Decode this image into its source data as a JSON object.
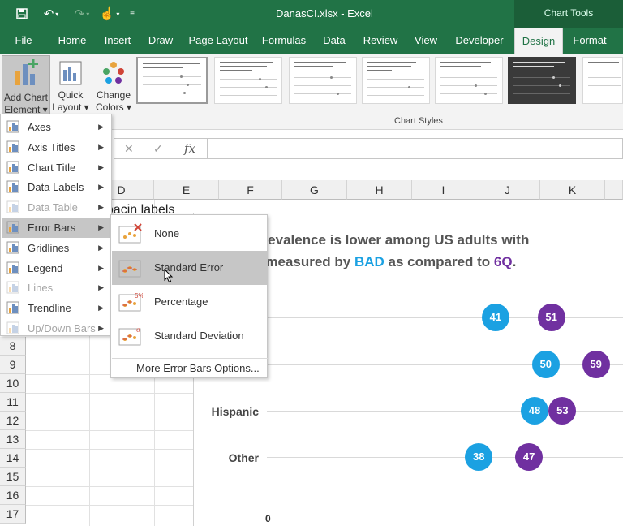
{
  "app": {
    "document_title": "DanasCI.xlsx  -  Excel",
    "context_tools": "Chart Tools"
  },
  "tabs": [
    {
      "label": "File",
      "active": false
    },
    {
      "label": "Home",
      "active": false
    },
    {
      "label": "Insert",
      "active": false
    },
    {
      "label": "Draw",
      "active": false
    },
    {
      "label": "Page Layout",
      "active": false
    },
    {
      "label": "Formulas",
      "active": false
    },
    {
      "label": "Data",
      "active": false
    },
    {
      "label": "Review",
      "active": false
    },
    {
      "label": "View",
      "active": false
    },
    {
      "label": "Developer",
      "active": false
    },
    {
      "label": "Design",
      "active": true
    },
    {
      "label": "Format",
      "active": false
    }
  ],
  "ribbon": {
    "add_chart_element": {
      "line1": "Add Chart",
      "line2": "Element ▾"
    },
    "quick_layout": {
      "line1": "Quick",
      "line2": "Layout ▾"
    },
    "change_colors": {
      "line1": "Change",
      "line2": "Colors ▾"
    },
    "chart_styles_label": "Chart Styles"
  },
  "formula_bar": {
    "cancel_icon": "✕",
    "enter_icon": "✓",
    "fx_label": "fx",
    "value": ""
  },
  "grid": {
    "columns": [
      "D",
      "E",
      "F",
      "G",
      "H",
      "I",
      "J",
      "K"
    ],
    "rows": [
      "8",
      "9",
      "10",
      "11",
      "12",
      "13",
      "14",
      "15",
      "16",
      "17"
    ],
    "cell_text": "t spacin labels"
  },
  "chart": {
    "title_line1": "y prevalence is lower among US adults with",
    "title_line2_pre": "ies measured by ",
    "title_bad": "BAD",
    "title_mid": " as compared to ",
    "title_6q": "6Q",
    "title_end": ".",
    "x_tick": "0",
    "colors": {
      "bad": "#1ba1e2",
      "sixq": "#7030a0"
    }
  },
  "chart_data": {
    "type": "scatter",
    "title": "y prevalence is lower among US adults with ies measured by BAD as compared to 6Q.",
    "categories": [
      "",
      "",
      "Hispanic",
      "Other"
    ],
    "series": [
      {
        "name": "BAD",
        "values": [
          41,
          50,
          48,
          38
        ]
      },
      {
        "name": "6Q",
        "values": [
          51,
          59,
          53,
          47
        ]
      }
    ],
    "x_tick_labels": [
      "0"
    ]
  },
  "menu": {
    "items": [
      {
        "label": "Axes",
        "icon": "axes-icon",
        "disabled": false
      },
      {
        "label": "Axis Titles",
        "icon": "axis-titles-icon",
        "disabled": false
      },
      {
        "label": "Chart Title",
        "icon": "chart-title-icon",
        "disabled": false
      },
      {
        "label": "Data Labels",
        "icon": "data-labels-icon",
        "disabled": false
      },
      {
        "label": "Data Table",
        "icon": "data-table-icon",
        "disabled": true
      },
      {
        "label": "Error Bars",
        "icon": "error-bars-icon",
        "disabled": false,
        "hover": true
      },
      {
        "label": "Gridlines",
        "icon": "gridlines-icon",
        "disabled": false
      },
      {
        "label": "Legend",
        "icon": "legend-icon",
        "disabled": false
      },
      {
        "label": "Lines",
        "icon": "lines-icon",
        "disabled": true
      },
      {
        "label": "Trendline",
        "icon": "trendline-icon",
        "disabled": false
      },
      {
        "label": "Up/Down Bars",
        "icon": "updown-bars-icon",
        "disabled": true
      }
    ]
  },
  "submenu": {
    "items": [
      {
        "label": "None",
        "icon": "error-bars-none-icon"
      },
      {
        "label": "Standard Error",
        "icon": "error-bars-standard-error-icon",
        "hover": true
      },
      {
        "label": "Percentage",
        "icon": "error-bars-percentage-icon"
      },
      {
        "label": "Standard Deviation",
        "icon": "error-bars-std-dev-icon"
      }
    ],
    "more_options": "More Error Bars Options..."
  }
}
